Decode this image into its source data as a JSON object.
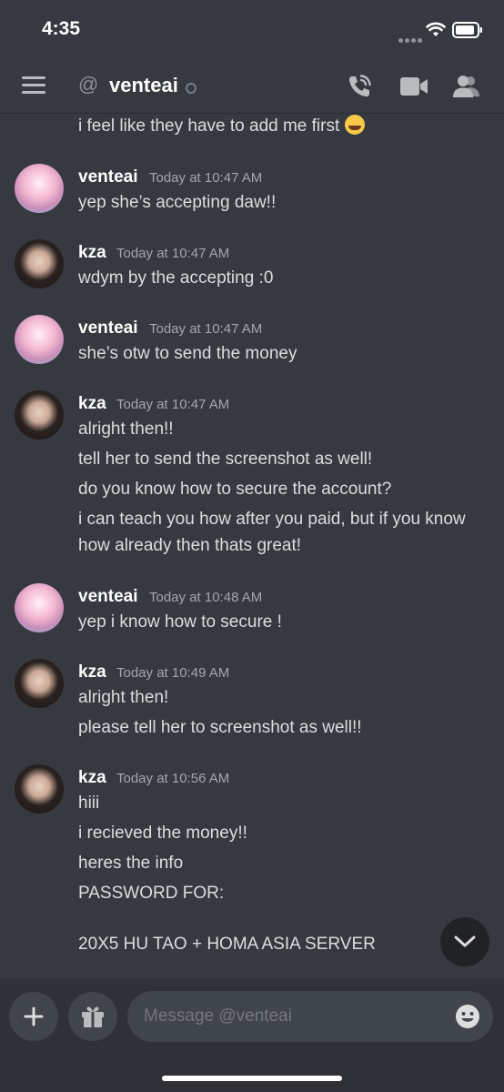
{
  "status_bar": {
    "time": "4:35"
  },
  "header": {
    "channel_name": "venteai"
  },
  "messages": {
    "top_line": "i feel like they have to add me first",
    "groups": [
      {
        "author": "venteai",
        "time": "Today at 10:47 AM",
        "lines": [
          "yep she’s accepting daw!!"
        ]
      },
      {
        "author": "kza",
        "time": "Today at 10:47 AM",
        "lines": [
          "wdym by the accepting :0"
        ]
      },
      {
        "author": "venteai",
        "time": "Today at 10:47 AM",
        "lines": [
          "she’s otw to send the money"
        ]
      },
      {
        "author": "kza",
        "time": "Today at 10:47 AM",
        "lines": [
          "alright then!!",
          "tell her to send the screenshot as well!",
          "do you know how to secure the account?",
          "i can teach you how after you paid, but if you know",
          "how already then thats great!"
        ]
      },
      {
        "author": "venteai",
        "time": "Today at 10:48 AM",
        "lines": [
          "yep i know how to secure !"
        ]
      },
      {
        "author": "kza",
        "time": "Today at 10:49 AM",
        "lines": [
          "alright then!",
          "please tell her to screenshot as well!!"
        ]
      },
      {
        "author": "kza",
        "time": "Today at 10:56 AM",
        "lines": [
          "hiii",
          "i recieved the money!!",
          "heres the info",
          "PASSWORD FOR:",
          "20X5 HU TAO + HOMA ASIA SERVER"
        ]
      }
    ]
  },
  "composer": {
    "placeholder": "Message @venteai"
  },
  "icons": {
    "menu": "hamburger-menu-icon",
    "at": "at-sign-icon",
    "call": "phone-call-icon",
    "video": "video-camera-icon",
    "members": "members-icon",
    "add": "plus-icon",
    "gift": "gift-icon",
    "emoji": "emoji-smile-icon",
    "scroll": "chevron-down-icon"
  },
  "colors": {
    "background": "#36393f",
    "composer": "#2f3136",
    "input": "#40444b",
    "text": "#dcddde",
    "timestamp": "#a3a6aa"
  }
}
